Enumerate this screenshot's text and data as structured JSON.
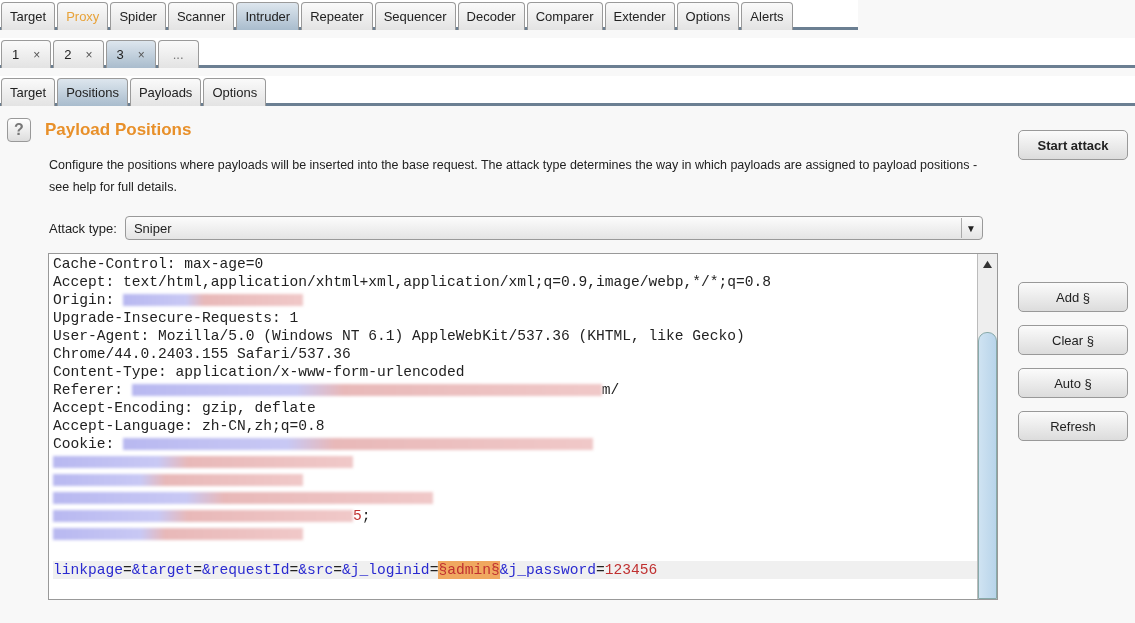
{
  "main_tabs": [
    {
      "label": "Target",
      "selected": false,
      "highlighted": false
    },
    {
      "label": "Proxy",
      "selected": false,
      "highlighted": true
    },
    {
      "label": "Spider",
      "selected": false,
      "highlighted": false
    },
    {
      "label": "Scanner",
      "selected": false,
      "highlighted": false
    },
    {
      "label": "Intruder",
      "selected": true,
      "highlighted": false
    },
    {
      "label": "Repeater",
      "selected": false,
      "highlighted": false
    },
    {
      "label": "Sequencer",
      "selected": false,
      "highlighted": false
    },
    {
      "label": "Decoder",
      "selected": false,
      "highlighted": false
    },
    {
      "label": "Comparer",
      "selected": false,
      "highlighted": false
    },
    {
      "label": "Extender",
      "selected": false,
      "highlighted": false
    },
    {
      "label": "Options",
      "selected": false,
      "highlighted": false
    },
    {
      "label": "Alerts",
      "selected": false,
      "highlighted": false
    }
  ],
  "attack_tabs": [
    {
      "label": "1",
      "close": "×",
      "selected": false
    },
    {
      "label": "2",
      "close": "×",
      "selected": false
    },
    {
      "label": "3",
      "close": "×",
      "selected": true
    },
    {
      "label": "...",
      "selected": false
    }
  ],
  "sub_tabs": [
    {
      "label": "Target",
      "selected": false
    },
    {
      "label": "Positions",
      "selected": true
    },
    {
      "label": "Payloads",
      "selected": false
    },
    {
      "label": "Options",
      "selected": false
    }
  ],
  "panel": {
    "help": "?",
    "title": "Payload Positions",
    "description": "Configure the positions where payloads will be inserted into the base request. The attack type determines the way in which payloads are assigned to payload positions - see help for full details.",
    "attack_type_label": "Attack type:",
    "attack_type": "Sniper",
    "dropdown_arrow": "▼"
  },
  "request_lines": [
    {
      "segments": [
        {
          "kind": "plain",
          "text": "Cache-Control: max-age=0"
        }
      ]
    },
    {
      "segments": [
        {
          "kind": "plain",
          "text": "Accept: text/html,application/xhtml+xml,application/xml;q=0.9,image/webp,*/*;q=0.8"
        }
      ]
    },
    {
      "segments": [
        {
          "kind": "plain",
          "text": "Origin: "
        },
        {
          "kind": "redacted"
        }
      ]
    },
    {
      "segments": [
        {
          "kind": "plain",
          "text": "Upgrade-Insecure-Requests: 1"
        }
      ]
    },
    {
      "segments": [
        {
          "kind": "plain",
          "text": "User-Agent: Mozilla/5.0 (Windows NT 6.1) AppleWebKit/537.36 (KHTML, like Gecko)"
        }
      ]
    },
    {
      "segments": [
        {
          "kind": "plain",
          "text": "Chrome/44.0.2403.155 Safari/537.36"
        }
      ]
    },
    {
      "segments": [
        {
          "kind": "plain",
          "text": "Content-Type: application/x-www-form-urlencoded"
        }
      ]
    },
    {
      "segments": [
        {
          "kind": "plain",
          "text": "Referer: "
        },
        {
          "kind": "redacted"
        },
        {
          "kind": "plain",
          "text": "m/"
        }
      ]
    },
    {
      "segments": [
        {
          "kind": "plain",
          "text": "Accept-Encoding: gzip, deflate"
        }
      ]
    },
    {
      "segments": [
        {
          "kind": "plain",
          "text": "Accept-Language: zh-CN,zh;q=0.8"
        }
      ]
    },
    {
      "segments": [
        {
          "kind": "plain",
          "text": "Cookie: "
        },
        {
          "kind": "redacted"
        }
      ]
    },
    {
      "segments": [
        {
          "kind": "redacted"
        }
      ]
    },
    {
      "segments": [
        {
          "kind": "redacted"
        }
      ]
    },
    {
      "segments": [
        {
          "kind": "redacted"
        }
      ]
    },
    {
      "segments": [
        {
          "kind": "redacted"
        },
        {
          "kind": "value",
          "text": "5"
        },
        {
          "kind": "plain",
          "text": ";"
        }
      ]
    },
    {
      "segments": [
        {
          "kind": "redacted"
        }
      ]
    },
    {
      "current": true,
      "gap_before": true,
      "segments": [
        {
          "kind": "name",
          "text": "linkpage"
        },
        {
          "kind": "plain",
          "text": "="
        },
        {
          "kind": "name",
          "text": "&target"
        },
        {
          "kind": "plain",
          "text": "="
        },
        {
          "kind": "name",
          "text": "&requestId"
        },
        {
          "kind": "plain",
          "text": "="
        },
        {
          "kind": "name",
          "text": "&src"
        },
        {
          "kind": "plain",
          "text": "="
        },
        {
          "kind": "name",
          "text": "&j_loginid"
        },
        {
          "kind": "plain",
          "text": "="
        },
        {
          "kind": "payload",
          "text": "§admin§"
        },
        {
          "kind": "name",
          "text": "&j_password"
        },
        {
          "kind": "plain",
          "text": "="
        },
        {
          "kind": "value",
          "text": "123456"
        }
      ]
    }
  ],
  "buttons": {
    "start": "Start attack",
    "side": [
      "Add §",
      "Clear §",
      "Auto §",
      "Refresh"
    ]
  }
}
